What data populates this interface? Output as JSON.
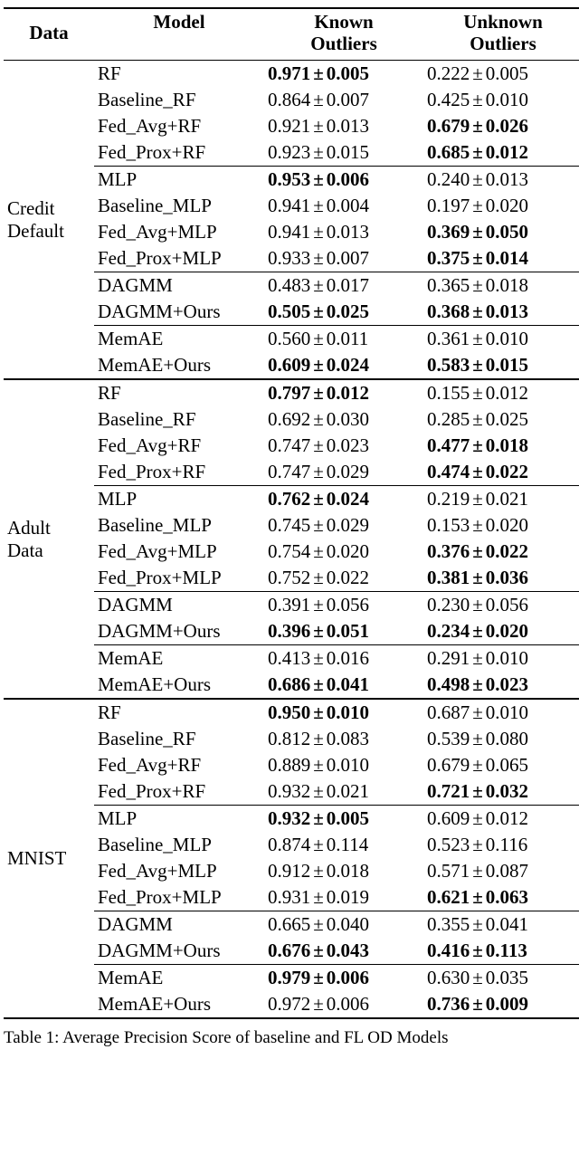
{
  "headers": {
    "data": "Data",
    "model": "Model",
    "known_l1": "Known",
    "known_l2": "Outliers",
    "unknown_l1": "Unknown",
    "unknown_l2": "Outliers"
  },
  "caption_prefix": "Table 1:",
  "caption_rest": " Average Precision Score of baseline and FL OD Models",
  "chart_data": {
    "type": "table",
    "title": "Average Precision Score of baseline and FL OD Models",
    "columns": [
      "Data",
      "Model",
      "Known Outliers (mean ± std)",
      "Unknown Outliers (mean ± std)"
    ],
    "bold_marks_best_in_group": true,
    "datasets": [
      {
        "name": "Credit Default",
        "groups": [
          {
            "rows": [
              {
                "model": "RF",
                "known": {
                  "mean": 0.971,
                  "std": 0.005,
                  "bold": true
                },
                "unknown": {
                  "mean": 0.222,
                  "std": 0.005,
                  "bold": false
                }
              },
              {
                "model": "Baseline_RF",
                "known": {
                  "mean": 0.864,
                  "std": 0.007,
                  "bold": false
                },
                "unknown": {
                  "mean": 0.425,
                  "std": 0.01,
                  "bold": false
                }
              },
              {
                "model": "Fed_Avg+RF",
                "known": {
                  "mean": 0.921,
                  "std": 0.013,
                  "bold": false
                },
                "unknown": {
                  "mean": 0.679,
                  "std": 0.026,
                  "bold": true
                }
              },
              {
                "model": "Fed_Prox+RF",
                "known": {
                  "mean": 0.923,
                  "std": 0.015,
                  "bold": false
                },
                "unknown": {
                  "mean": 0.685,
                  "std": 0.012,
                  "bold": true
                }
              }
            ]
          },
          {
            "rows": [
              {
                "model": "MLP",
                "known": {
                  "mean": 0.953,
                  "std": 0.006,
                  "bold": true
                },
                "unknown": {
                  "mean": 0.24,
                  "std": 0.013,
                  "bold": false
                }
              },
              {
                "model": "Baseline_MLP",
                "known": {
                  "mean": 0.941,
                  "std": 0.004,
                  "bold": false
                },
                "unknown": {
                  "mean": 0.197,
                  "std": 0.02,
                  "bold": false
                }
              },
              {
                "model": "Fed_Avg+MLP",
                "known": {
                  "mean": 0.941,
                  "std": 0.013,
                  "bold": false
                },
                "unknown": {
                  "mean": 0.369,
                  "std": 0.05,
                  "bold": true
                }
              },
              {
                "model": "Fed_Prox+MLP",
                "known": {
                  "mean": 0.933,
                  "std": 0.007,
                  "bold": false
                },
                "unknown": {
                  "mean": 0.375,
                  "std": 0.014,
                  "bold": true
                }
              }
            ]
          },
          {
            "rows": [
              {
                "model": "DAGMM",
                "known": {
                  "mean": 0.483,
                  "std": 0.017,
                  "bold": false
                },
                "unknown": {
                  "mean": 0.365,
                  "std": 0.018,
                  "bold": false
                }
              },
              {
                "model": "DAGMM+Ours",
                "known": {
                  "mean": 0.505,
                  "std": 0.025,
                  "bold": true
                },
                "unknown": {
                  "mean": 0.368,
                  "std": 0.013,
                  "bold": true
                }
              }
            ]
          },
          {
            "rows": [
              {
                "model": "MemAE",
                "known": {
                  "mean": 0.56,
                  "std": 0.011,
                  "bold": false
                },
                "unknown": {
                  "mean": 0.361,
                  "std": 0.01,
                  "bold": false
                }
              },
              {
                "model": "MemAE+Ours",
                "known": {
                  "mean": 0.609,
                  "std": 0.024,
                  "bold": true
                },
                "unknown": {
                  "mean": 0.583,
                  "std": 0.015,
                  "bold": true
                }
              }
            ]
          }
        ]
      },
      {
        "name": "Adult Data",
        "groups": [
          {
            "rows": [
              {
                "model": "RF",
                "known": {
                  "mean": 0.797,
                  "std": 0.012,
                  "bold": true
                },
                "unknown": {
                  "mean": 0.155,
                  "std": 0.012,
                  "bold": false
                }
              },
              {
                "model": "Baseline_RF",
                "known": {
                  "mean": 0.692,
                  "std": 0.03,
                  "bold": false
                },
                "unknown": {
                  "mean": 0.285,
                  "std": 0.025,
                  "bold": false
                }
              },
              {
                "model": "Fed_Avg+RF",
                "known": {
                  "mean": 0.747,
                  "std": 0.023,
                  "bold": false
                },
                "unknown": {
                  "mean": 0.477,
                  "std": 0.018,
                  "bold": true
                }
              },
              {
                "model": "Fed_Prox+RF",
                "known": {
                  "mean": 0.747,
                  "std": 0.029,
                  "bold": false
                },
                "unknown": {
                  "mean": 0.474,
                  "std": 0.022,
                  "bold": true
                }
              }
            ]
          },
          {
            "rows": [
              {
                "model": "MLP",
                "known": {
                  "mean": 0.762,
                  "std": 0.024,
                  "bold": true
                },
                "unknown": {
                  "mean": 0.219,
                  "std": 0.021,
                  "bold": false
                }
              },
              {
                "model": "Baseline_MLP",
                "known": {
                  "mean": 0.745,
                  "std": 0.029,
                  "bold": false
                },
                "unknown": {
                  "mean": 0.153,
                  "std": 0.02,
                  "bold": false
                }
              },
              {
                "model": "Fed_Avg+MLP",
                "known": {
                  "mean": 0.754,
                  "std": 0.02,
                  "bold": false
                },
                "unknown": {
                  "mean": 0.376,
                  "std": 0.022,
                  "bold": true
                }
              },
              {
                "model": "Fed_Prox+MLP",
                "known": {
                  "mean": 0.752,
                  "std": 0.022,
                  "bold": false
                },
                "unknown": {
                  "mean": 0.381,
                  "std": 0.036,
                  "bold": true
                }
              }
            ]
          },
          {
            "rows": [
              {
                "model": "DAGMM",
                "known": {
                  "mean": 0.391,
                  "std": 0.056,
                  "bold": false
                },
                "unknown": {
                  "mean": 0.23,
                  "std": 0.056,
                  "bold": false
                }
              },
              {
                "model": "DAGMM+Ours",
                "known": {
                  "mean": 0.396,
                  "std": 0.051,
                  "bold": true
                },
                "unknown": {
                  "mean": 0.234,
                  "std": 0.02,
                  "bold": true
                }
              }
            ]
          },
          {
            "rows": [
              {
                "model": "MemAE",
                "known": {
                  "mean": 0.413,
                  "std": 0.016,
                  "bold": false
                },
                "unknown": {
                  "mean": 0.291,
                  "std": 0.01,
                  "bold": false
                }
              },
              {
                "model": "MemAE+Ours",
                "known": {
                  "mean": 0.686,
                  "std": 0.041,
                  "bold": true
                },
                "unknown": {
                  "mean": 0.498,
                  "std": 0.023,
                  "bold": true
                }
              }
            ]
          }
        ]
      },
      {
        "name": "MNIST",
        "groups": [
          {
            "rows": [
              {
                "model": "RF",
                "known": {
                  "mean": 0.95,
                  "std": 0.01,
                  "bold": true
                },
                "unknown": {
                  "mean": 0.687,
                  "std": 0.01,
                  "bold": false
                }
              },
              {
                "model": "Baseline_RF",
                "known": {
                  "mean": 0.812,
                  "std": 0.083,
                  "bold": false
                },
                "unknown": {
                  "mean": 0.539,
                  "std": 0.08,
                  "bold": false
                }
              },
              {
                "model": "Fed_Avg+RF",
                "known": {
                  "mean": 0.889,
                  "std": 0.01,
                  "bold": false
                },
                "unknown": {
                  "mean": 0.679,
                  "std": 0.065,
                  "bold": false
                }
              },
              {
                "model": "Fed_Prox+RF",
                "known": {
                  "mean": 0.932,
                  "std": 0.021,
                  "bold": false
                },
                "unknown": {
                  "mean": 0.721,
                  "std": 0.032,
                  "bold": true
                }
              }
            ]
          },
          {
            "rows": [
              {
                "model": "MLP",
                "known": {
                  "mean": 0.932,
                  "std": 0.005,
                  "bold": true
                },
                "unknown": {
                  "mean": 0.609,
                  "std": 0.012,
                  "bold": false
                }
              },
              {
                "model": "Baseline_MLP",
                "known": {
                  "mean": 0.874,
                  "std": 0.114,
                  "bold": false
                },
                "unknown": {
                  "mean": 0.523,
                  "std": 0.116,
                  "bold": false
                }
              },
              {
                "model": "Fed_Avg+MLP",
                "known": {
                  "mean": 0.912,
                  "std": 0.018,
                  "bold": false
                },
                "unknown": {
                  "mean": 0.571,
                  "std": 0.087,
                  "bold": false
                }
              },
              {
                "model": "Fed_Prox+MLP",
                "known": {
                  "mean": 0.931,
                  "std": 0.019,
                  "bold": false
                },
                "unknown": {
                  "mean": 0.621,
                  "std": 0.063,
                  "bold": true
                }
              }
            ]
          },
          {
            "rows": [
              {
                "model": "DAGMM",
                "known": {
                  "mean": 0.665,
                  "std": 0.04,
                  "bold": false
                },
                "unknown": {
                  "mean": 0.355,
                  "std": 0.041,
                  "bold": false
                }
              },
              {
                "model": "DAGMM+Ours",
                "known": {
                  "mean": 0.676,
                  "std": 0.043,
                  "bold": true
                },
                "unknown": {
                  "mean": 0.416,
                  "std": 0.113,
                  "bold": true
                }
              }
            ]
          },
          {
            "rows": [
              {
                "model": "MemAE",
                "known": {
                  "mean": 0.979,
                  "std": 0.006,
                  "bold": true
                },
                "unknown": {
                  "mean": 0.63,
                  "std": 0.035,
                  "bold": false
                }
              },
              {
                "model": "MemAE+Ours",
                "known": {
                  "mean": 0.972,
                  "std": 0.006,
                  "bold": false
                },
                "unknown": {
                  "mean": 0.736,
                  "std": 0.009,
                  "bold": true
                }
              }
            ]
          }
        ]
      }
    ]
  }
}
